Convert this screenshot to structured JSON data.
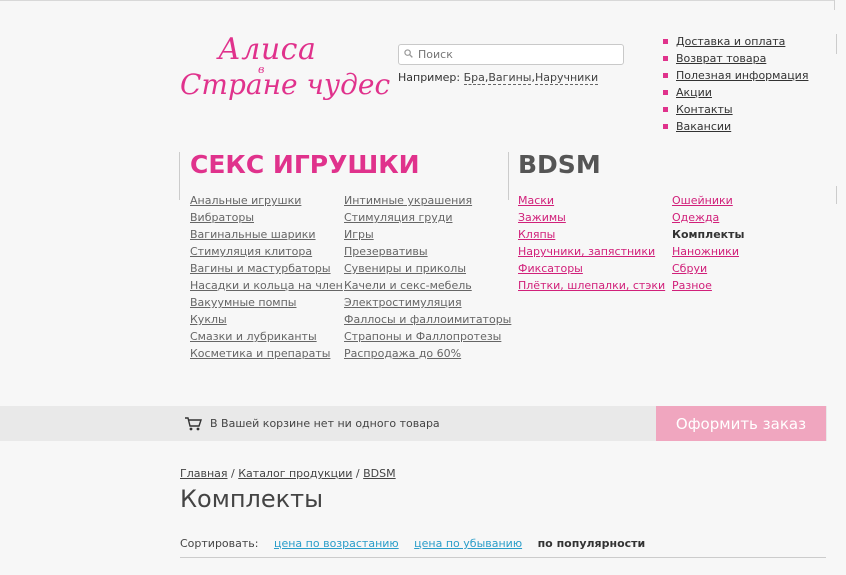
{
  "logo": {
    "line1": "Алиса",
    "line2": "в",
    "line3": "Стране чудес"
  },
  "search": {
    "placeholder": "Поиск",
    "example_prefix": "Например: ",
    "examples": [
      "Бра",
      "Вагины",
      "Наручники"
    ]
  },
  "top_links": [
    "Доставка и оплата",
    "Возврат товара",
    "Полезная информация",
    "Акции",
    "Контакты",
    "Вакансии"
  ],
  "categories": {
    "sex_toys": {
      "title": "СЕКС ИГРУШКИ",
      "col1": [
        "Анальные игрушки",
        "Вибраторы",
        "Вагинальные шарики",
        "Стимуляция клитора",
        "Вагины и мастурбаторы",
        "Насадки и кольца на член",
        "Вакуумные помпы",
        "Куклы",
        "Смазки и лубриканты",
        "Косметика и препараты"
      ],
      "col2": [
        "Интимные украшения",
        "Стимуляция груди",
        "Игры",
        "Презервативы",
        "Сувениры и приколы",
        "Качели и секс-мебель",
        "Электростимуляция",
        "Фаллосы и фаллоимитаторы",
        "Страпоны и Фаллопротезы",
        "Распродажа до 60%"
      ]
    },
    "bdsm": {
      "title": "BDSM",
      "col1": [
        "Маски",
        "Зажимы",
        "Кляпы",
        "Наручники, запястники",
        "Фиксаторы",
        "Плётки, шлепалки, стэки"
      ],
      "col2": [
        "Ошейники",
        "Одежда",
        "Комплекты",
        "Наножники",
        "Сбруи",
        "Разное"
      ],
      "active": "Комплекты"
    }
  },
  "cart": {
    "empty_text": "В Вашей корзине нет ни одного товара",
    "order_button": "Оформить заказ"
  },
  "breadcrumb": {
    "items": [
      "Главная",
      "Каталог продукции",
      "BDSM"
    ],
    "separator": "/"
  },
  "page_title": "Комплекты",
  "sort": {
    "label": "Сортировать:",
    "options": [
      "цена по возрастанию",
      "цена по убыванию"
    ],
    "current": "по популярности"
  },
  "colors": {
    "accent": "#e0328c",
    "order_button": "#f0a6bf",
    "sort_link": "#2a9dc9"
  }
}
